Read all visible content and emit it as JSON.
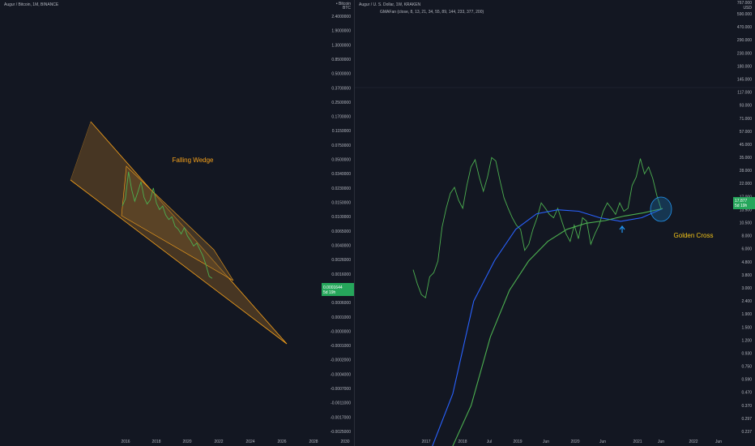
{
  "left": {
    "title": "Augur / Bitcoin, 1M, BINANCE",
    "axis_unit": "BTC",
    "axis_header": "• Bitcoin",
    "price_labels": [
      "2.4000000",
      "1.9000000",
      "1.3000000",
      "0.8500000",
      "0.5000000",
      "0.3700000",
      "0.2500000",
      "0.1700000",
      "0.1150000",
      "0.0750000",
      "0.0500000",
      "0.0340000",
      "0.0230000",
      "0.0150000",
      "0.0100000",
      "0.0065000",
      "0.0040000",
      "0.0026000",
      "0.0016000",
      "0.0010000",
      "0.0006000",
      "0.0001000",
      "-0.0000000",
      "-0.0001000",
      "-0.0002000",
      "-0.0004000",
      "-0.0007000",
      "-0.0011000",
      "-0.0017000",
      "-0.0025000"
    ],
    "current_price": "0.0001644",
    "countdown": "5d 19h",
    "time_labels": [
      "2016",
      "2018",
      "2020",
      "2022",
      "2024",
      "2026",
      "2028",
      "2030"
    ],
    "annotation": "Falling Wedge"
  },
  "right": {
    "title": "Augur / U. S. Dollar, 1W, KRAKEN",
    "indicator": "GMAFan (close, 8, 13, 21, 34, 55, 89, 144, 233, 377, 200)",
    "axis_unit": "USD",
    "axis_header": "767.000",
    "price_labels": [
      "590.000",
      "470.000",
      "290.000",
      "230.000",
      "180.000",
      "145.000",
      "117.000",
      "93.000",
      "71.000",
      "57.000",
      "45.000",
      "35.000",
      "28.000",
      "22.000",
      "17.000",
      "13.500",
      "10.500",
      "8.000",
      "6.000",
      "4.800",
      "3.800",
      "3.000",
      "2.400",
      "1.900",
      "1.500",
      "1.200",
      "0.930",
      "0.750",
      "0.590",
      "0.470",
      "0.370",
      "0.297",
      "0.237"
    ],
    "current_price": "17.877",
    "countdown": "5d 19h",
    "time_labels": [
      "2017",
      "2018",
      "Jul",
      "2019",
      "Jun",
      "2020",
      "Jun",
      "2021",
      "Jun",
      "2022",
      "Jun"
    ],
    "annotation": "Golden Cross"
  },
  "colors": {
    "background": "#131722",
    "price_line": "#4caf50",
    "wedge_fill": "#4e3a23",
    "wedge_border": "#f7a21b",
    "ma_blue": "#2962ff",
    "ma_green": "#4caf50",
    "highlight": "#2196f3",
    "annotation": "#f5c518",
    "text": "#b2b5be"
  },
  "chart_data": [
    {
      "type": "line",
      "title": "Augur / Bitcoin, 1M, BINANCE",
      "series": [
        {
          "values": [
            0.0042,
            0.0058,
            0.0195,
            0.0088,
            0.0052,
            0.0078,
            0.0125,
            0.0062,
            0.0046,
            0.0055,
            0.0094,
            0.0048,
            0.0036,
            0.0042,
            0.0028,
            0.0023,
            0.0026,
            0.0017,
            0.0015,
            0.0012,
            0.0016,
            0.0011,
            0.0009,
            0.0007,
            0.0008,
            0.0006,
            0.00045,
            0.0003,
            0.00018,
            0.0001644
          ]
        }
      ]
    },
    {
      "type": "line",
      "title": "Augur / U. S. Dollar, 1W, KRAKEN",
      "series": [
        {
          "name": "price",
          "values": [
            5.5,
            4.2,
            3.4,
            3.2,
            4.8,
            5.2,
            6.5,
            12.5,
            18,
            24,
            27,
            21,
            18,
            28,
            40,
            46,
            33,
            25,
            33,
            48,
            45,
            31,
            22,
            18,
            15,
            13,
            12,
            8,
            9,
            12,
            15,
            20,
            18,
            16,
            15,
            18,
            14,
            11,
            9.5,
            13,
            10,
            15,
            14,
            9,
            11,
            13,
            17,
            20,
            18,
            16,
            20,
            17,
            18,
            28,
            33,
            47,
            35,
            40,
            32,
            23,
            17.9
          ]
        },
        {
          "name": "MA blue",
          "values": [
            0.09,
            0.5,
            3,
            6.6,
            12,
            16.2,
            17.5,
            17,
            15,
            14,
            15,
            17.9
          ]
        },
        {
          "name": "MA green",
          "values": [
            0.09,
            0.4,
            1.5,
            3.7,
            6.5,
            9.5,
            12,
            13.5,
            14.2,
            15.5,
            16.5,
            17.9
          ]
        }
      ]
    }
  ]
}
